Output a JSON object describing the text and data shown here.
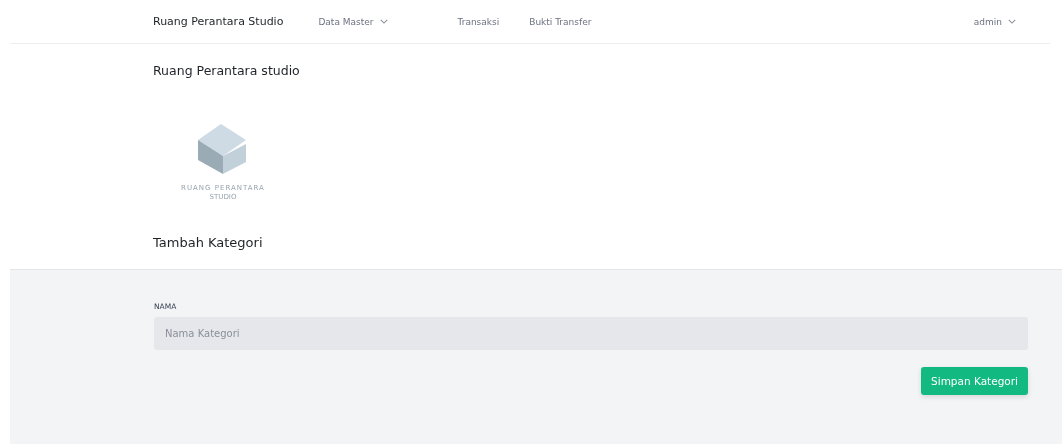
{
  "navbar": {
    "brand": "Ruang Perantara Studio",
    "items": [
      {
        "label": "Data Master",
        "dropdown": true
      },
      {
        "label": "Transaksi",
        "dropdown": false
      },
      {
        "label": "Bukti Transfer",
        "dropdown": false
      }
    ],
    "user": {
      "label": "admin",
      "dropdown": true
    }
  },
  "site_title": "Ruang Perantara studio",
  "logo": {
    "name": "RUANG PERANTARA",
    "tagline": "STUDIO"
  },
  "section_title": "Tambah Kategori",
  "form": {
    "fields": [
      {
        "label": "NAMA",
        "placeholder": "Nama Kategori"
      }
    ],
    "submit": "Simpan Kategori"
  }
}
